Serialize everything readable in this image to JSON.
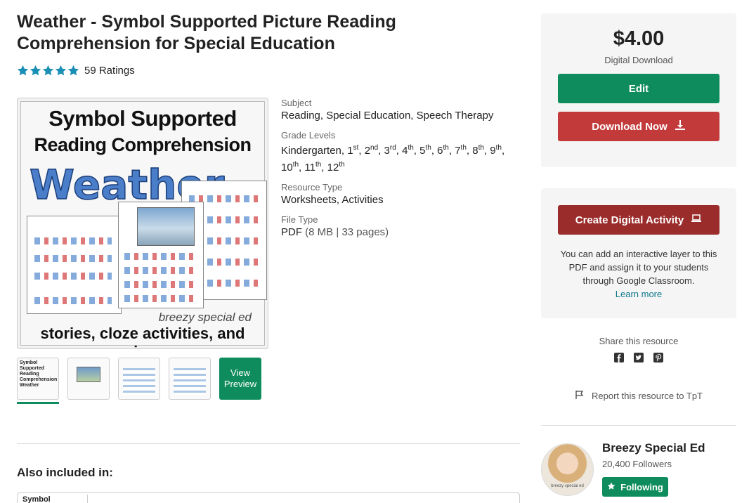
{
  "product": {
    "title": "Weather - Symbol Supported Picture Reading Comprehension for Special Education",
    "ratings_text": "59 Ratings",
    "stars": 5
  },
  "cover": {
    "line1": "Symbol Supported",
    "line2": "Reading Comprehension",
    "line3": "Weather",
    "brand": "breezy special ed",
    "footer": "stories, cloze activities, and quizzes"
  },
  "preview": {
    "label": "View Preview",
    "thumb_title": "Symbol Supported Reading Comprehension Weather"
  },
  "meta": {
    "subject_label": "Subject",
    "subject_value": "Reading, Special Education, Speech Therapy",
    "grade_label": "Grade Levels",
    "grade_prefix": "Kindergarten, 1",
    "resource_label": "Resource Type",
    "resource_value": "Worksheets, Activities",
    "filetype_label": "File Type",
    "filetype_value": "PDF",
    "filetype_size": "(8 MB",
    "filetype_sep": "|",
    "filetype_pages": "33 pages)"
  },
  "grades": [
    {
      "num": "2",
      "sup": "nd"
    },
    {
      "num": "3",
      "sup": "rd"
    },
    {
      "num": "4",
      "sup": "th"
    },
    {
      "num": "5",
      "sup": "th"
    },
    {
      "num": "6",
      "sup": "th"
    },
    {
      "num": "7",
      "sup": "th"
    },
    {
      "num": "8",
      "sup": "th"
    },
    {
      "num": "9",
      "sup": "th"
    },
    {
      "num": "10",
      "sup": "th"
    },
    {
      "num": "11",
      "sup": "th"
    },
    {
      "num": "12",
      "sup": "th"
    }
  ],
  "grade_first_sup": "st",
  "also": {
    "label": "Also included in:",
    "bundle_thumb": "Symbol Supported"
  },
  "buy": {
    "price": "$4.00",
    "price_sub": "Digital Download",
    "edit_label": "Edit",
    "download_label": "Download Now"
  },
  "digital": {
    "button_label": "Create Digital Activity",
    "description": "You can add an interactive layer to this PDF and assign it to your students through Google Classroom.",
    "learn_more": "Learn more"
  },
  "share": {
    "label": "Share this resource",
    "icons": [
      "facebook-icon",
      "twitter-icon",
      "pinterest-icon"
    ]
  },
  "report_label": "Report this resource to TpT",
  "seller": {
    "name": "Breezy Special Ed",
    "followers": "20,400 Followers",
    "follow_label": "Following",
    "avatar_text": "breezy special ed"
  },
  "colors": {
    "green": "#0f8c5d",
    "red": "#c33a3a",
    "dark_red": "#9b2c2c",
    "star": "#1a8fb5"
  }
}
